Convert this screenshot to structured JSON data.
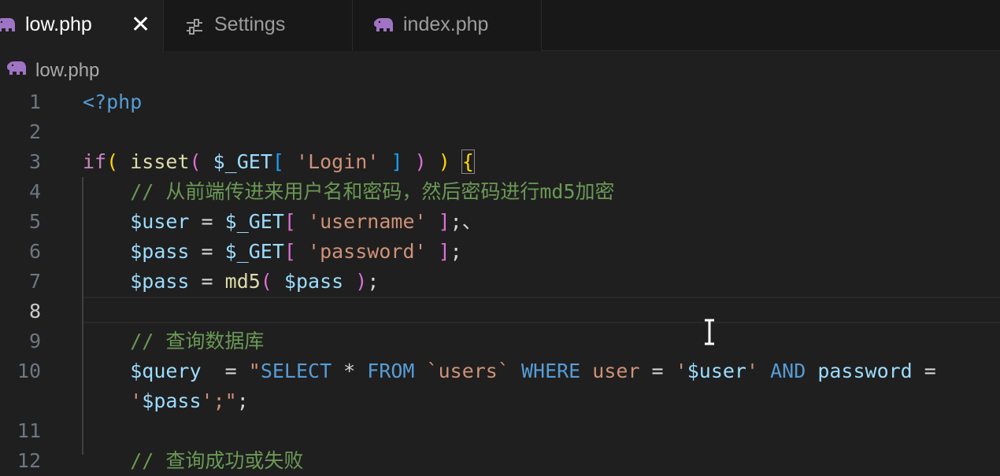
{
  "tabs": [
    {
      "label": "low.php",
      "icon": "php-elephant-icon",
      "active": true,
      "close": "✕"
    },
    {
      "label": "Settings",
      "icon": "settings-sliders-icon",
      "active": false
    },
    {
      "label": "index.php",
      "icon": "php-elephant-icon",
      "active": false
    }
  ],
  "breadcrumb": {
    "label": "low.php",
    "icon": "php-elephant-icon"
  },
  "editor": {
    "line_numbers": [
      "1",
      "2",
      "3",
      "4",
      "5",
      "6",
      "7",
      "8",
      "9",
      "10",
      "11",
      "12"
    ],
    "current_line": "8",
    "lines": [
      [
        {
          "t": "<?php",
          "c": "tag"
        }
      ],
      [],
      [
        {
          "t": "if",
          "c": "ctl"
        },
        {
          "t": "(",
          "c": "b1"
        },
        {
          "t": " ",
          "c": "op"
        },
        {
          "t": "isset",
          "c": "fn"
        },
        {
          "t": "(",
          "c": "b2"
        },
        {
          "t": " ",
          "c": "op"
        },
        {
          "t": "$_GET",
          "c": "var"
        },
        {
          "t": "[",
          "c": "b3"
        },
        {
          "t": " ",
          "c": "op"
        },
        {
          "t": "'Login'",
          "c": "str"
        },
        {
          "t": " ",
          "c": "op"
        },
        {
          "t": "]",
          "c": "b3"
        },
        {
          "t": " ",
          "c": "op"
        },
        {
          "t": ")",
          "c": "b2"
        },
        {
          "t": " ",
          "c": "op"
        },
        {
          "t": ")",
          "c": "b1"
        },
        {
          "t": " ",
          "c": "op"
        },
        {
          "t": "{",
          "c": "b1match"
        }
      ],
      [
        {
          "t": "    // 从前端传进来用户名和密码，然后密码进行md5加密",
          "c": "cmt"
        }
      ],
      [
        {
          "t": "    ",
          "c": "op"
        },
        {
          "t": "$user",
          "c": "var"
        },
        {
          "t": " = ",
          "c": "op"
        },
        {
          "t": "$_GET",
          "c": "var"
        },
        {
          "t": "[",
          "c": "b2"
        },
        {
          "t": " ",
          "c": "op"
        },
        {
          "t": "'username'",
          "c": "str"
        },
        {
          "t": " ",
          "c": "op"
        },
        {
          "t": "]",
          "c": "b2"
        },
        {
          "t": ";、",
          "c": "op"
        }
      ],
      [
        {
          "t": "    ",
          "c": "op"
        },
        {
          "t": "$pass",
          "c": "var"
        },
        {
          "t": " = ",
          "c": "op"
        },
        {
          "t": "$_GET",
          "c": "var"
        },
        {
          "t": "[",
          "c": "b2"
        },
        {
          "t": " ",
          "c": "op"
        },
        {
          "t": "'password'",
          "c": "str"
        },
        {
          "t": " ",
          "c": "op"
        },
        {
          "t": "]",
          "c": "b2"
        },
        {
          "t": ";",
          "c": "op"
        }
      ],
      [
        {
          "t": "    ",
          "c": "op"
        },
        {
          "t": "$pass",
          "c": "var"
        },
        {
          "t": " = ",
          "c": "op"
        },
        {
          "t": "md5",
          "c": "fn"
        },
        {
          "t": "(",
          "c": "b2"
        },
        {
          "t": " ",
          "c": "op"
        },
        {
          "t": "$pass",
          "c": "var"
        },
        {
          "t": " ",
          "c": "op"
        },
        {
          "t": ")",
          "c": "b2"
        },
        {
          "t": ";",
          "c": "op"
        }
      ],
      [],
      [
        {
          "t": "    // 查询数据库",
          "c": "cmt"
        }
      ],
      [
        {
          "t": "    ",
          "c": "op"
        },
        {
          "t": "$query",
          "c": "var"
        },
        {
          "t": "  = ",
          "c": "op"
        },
        {
          "t": "\"",
          "c": "str"
        },
        {
          "t": "SELECT",
          "c": "kw"
        },
        {
          "t": " * ",
          "c": "op"
        },
        {
          "t": "FROM",
          "c": "kw"
        },
        {
          "t": " `users` ",
          "c": "str"
        },
        {
          "t": "WHERE",
          "c": "kw"
        },
        {
          "t": " user ",
          "c": "str"
        },
        {
          "t": "=",
          "c": "op"
        },
        {
          "t": " '",
          "c": "str"
        },
        {
          "t": "$user",
          "c": "var"
        },
        {
          "t": "' ",
          "c": "str"
        },
        {
          "t": "AND",
          "c": "kw"
        },
        {
          "t": " ",
          "c": "op"
        },
        {
          "t": "password",
          "c": "var"
        },
        {
          "t": " =",
          "c": "op"
        }
      ],
      [
        {
          "t": "    ",
          "c": "op"
        },
        {
          "t": "'",
          "c": "str"
        },
        {
          "t": "$pass",
          "c": "var"
        },
        {
          "t": "';\"",
          "c": "str"
        },
        {
          "t": ";",
          "c": "op"
        }
      ],
      [],
      [
        {
          "t": "    // 查询成功或失败",
          "c": "cmt"
        }
      ]
    ]
  }
}
